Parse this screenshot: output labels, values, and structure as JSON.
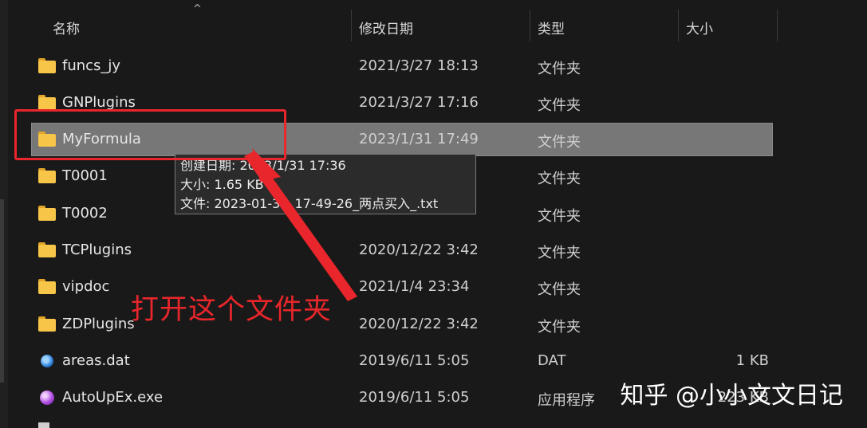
{
  "columns": {
    "name": "名称",
    "date": "修改日期",
    "type": "类型",
    "size": "大小",
    "sort_caret": "^"
  },
  "rows": [
    {
      "icon": "folder-icon",
      "name": "funcs_jy",
      "date": "2021/3/27 18:13",
      "type": "文件夹",
      "size": ""
    },
    {
      "icon": "folder-icon",
      "name": "GNPlugins",
      "date": "2021/3/27 17:16",
      "type": "文件夹",
      "size": ""
    },
    {
      "icon": "folder-icon",
      "name": "MyFormula",
      "date": "2023/1/31 17:49",
      "type": "文件夹",
      "size": "",
      "selected": true
    },
    {
      "icon": "folder-icon",
      "name": "T0001",
      "date": "",
      "type": "文件夹",
      "size": ""
    },
    {
      "icon": "folder-icon",
      "name": "T0002",
      "date": "",
      "type": "文件夹",
      "size": ""
    },
    {
      "icon": "folder-icon",
      "name": "TCPlugins",
      "date": "2020/12/22 3:42",
      "type": "文件夹",
      "size": ""
    },
    {
      "icon": "folder-icon",
      "name": "vipdoc",
      "date": "2021/1/4 23:34",
      "type": "文件夹",
      "size": ""
    },
    {
      "icon": "folder-icon",
      "name": "ZDPlugins",
      "date": "2020/12/22 3:42",
      "type": "文件夹",
      "size": ""
    },
    {
      "icon": "dat-file-icon",
      "name": "areas.dat",
      "date": "2019/6/11 5:05",
      "type": "DAT",
      "size": "1 KB"
    },
    {
      "icon": "exe-file-icon",
      "name": "AutoUpEx.exe",
      "date": "2019/6/11 5:05",
      "type": "应用程序",
      "size": "223 KB"
    }
  ],
  "tooltip": {
    "created": "创建日期: 2023/1/31 17:36",
    "size": "大小: 1.65 KB",
    "files": "文件: 2023-01-31_17-49-26_两点买入_.txt"
  },
  "annotation": {
    "text": "打开这个文件夹",
    "color": "#e8262b"
  },
  "watermark": "知乎 @小小文文日记",
  "colors": {
    "background": "#191919",
    "selected_row": "#777777",
    "folder": "#f7c548"
  }
}
